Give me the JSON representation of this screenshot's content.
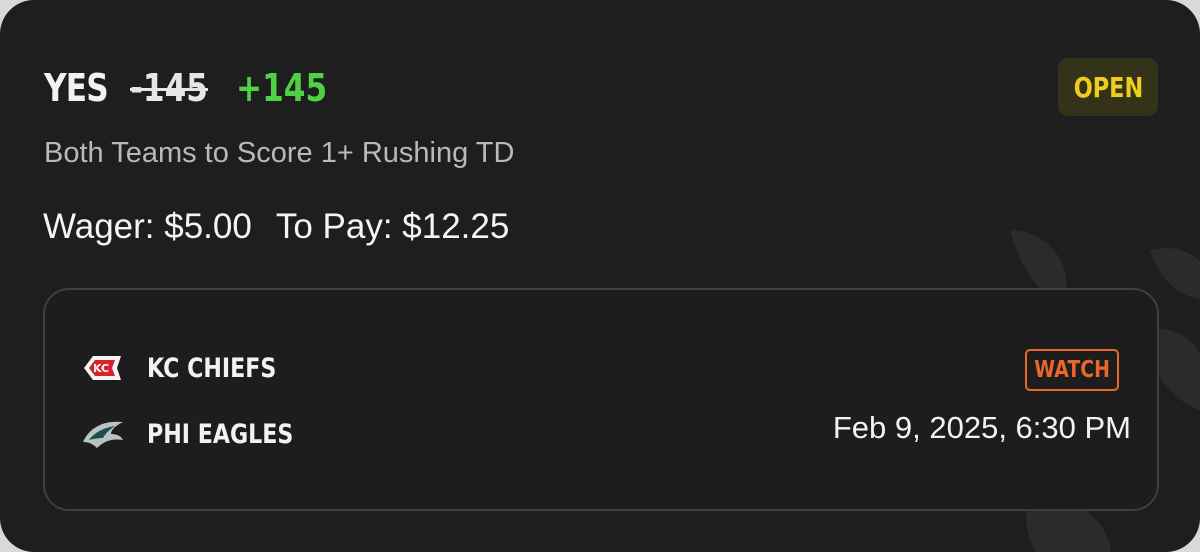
{
  "bet": {
    "pick": "YES",
    "original_odds": "-145",
    "boosted_odds": "+145",
    "status": "OPEN",
    "market": "Both Teams to Score 1+ Rushing TD",
    "wager_label": "Wager: $5.00",
    "payout_label": "To Pay: $12.25"
  },
  "game": {
    "teams": [
      {
        "name": "KC CHIEFS",
        "logo_icon": "chiefs-logo-icon"
      },
      {
        "name": "PHI EAGLES",
        "logo_icon": "eagles-logo-icon"
      }
    ],
    "watch_label": "WATCH",
    "datetime": "Feb 9, 2025, 6:30 PM"
  },
  "colors": {
    "card_bg": "#1e1e1e",
    "boosted_odds": "#4fd144",
    "status_text": "#f0cc1c",
    "status_bg": "#35321a",
    "watch_accent": "#e8672c",
    "muted_text": "#b9b9b9"
  }
}
